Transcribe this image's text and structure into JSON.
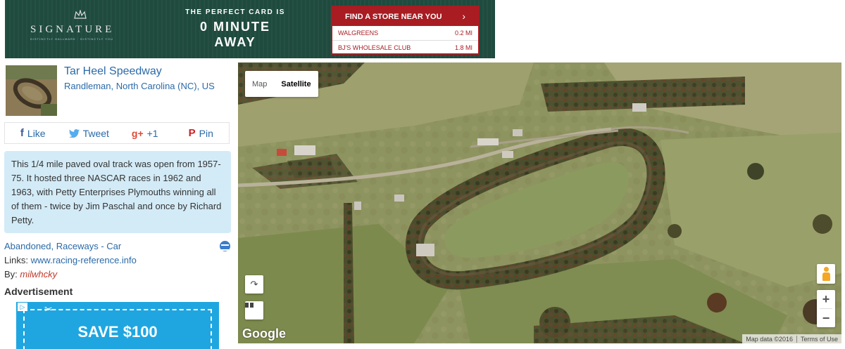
{
  "banner": {
    "brand": "SIGNATURE",
    "tagline": "DISTINCTLY HALLMARK · DISTINCTLY YOU",
    "headline_small": "THE PERFECT CARD IS",
    "headline_big_1": "0 MINUTE",
    "headline_big_2": "AWAY",
    "find_label": "FIND A STORE NEAR YOU",
    "stores": [
      {
        "name": "WALGREENS",
        "distance": "0.2 MI"
      },
      {
        "name": "BJ'S WHOLESALE CLUB",
        "distance": "1.8 MI"
      }
    ]
  },
  "place": {
    "title": "Tar Heel Speedway",
    "location": "Randleman, North Carolina (NC), US"
  },
  "share": {
    "like": "Like",
    "tweet": "Tweet",
    "gplus": "+1",
    "pin": "Pin"
  },
  "description": "This 1/4 mile paved oval track was open from 1957-75. It hosted three NASCAR races in 1962 and 1963, with Petty Enterprises Plymouths winning all of them - twice by Jim Paschal and once by Richard Petty.",
  "categories": "Abandoned, Raceways - Car",
  "links": {
    "label": "Links: ",
    "url": "www.racing-reference.info"
  },
  "by": {
    "label": "By: ",
    "user": "milwhcky"
  },
  "advertisement": {
    "label": "Advertisement",
    "coupon_text": "SAVE $100"
  },
  "map": {
    "type_map": "Map",
    "type_satellite": "Satellite",
    "logo": "Google",
    "attribution": "Map data ©2016",
    "terms": "Terms of Use",
    "zoom_in": "+",
    "zoom_out": "−"
  },
  "colors": {
    "link": "#2a6aa8",
    "banner_bg": "#1f4a3e",
    "store_red": "#a81c22",
    "desc_bg": "#d3ebf7",
    "coupon_blue": "#1fa6e0"
  }
}
